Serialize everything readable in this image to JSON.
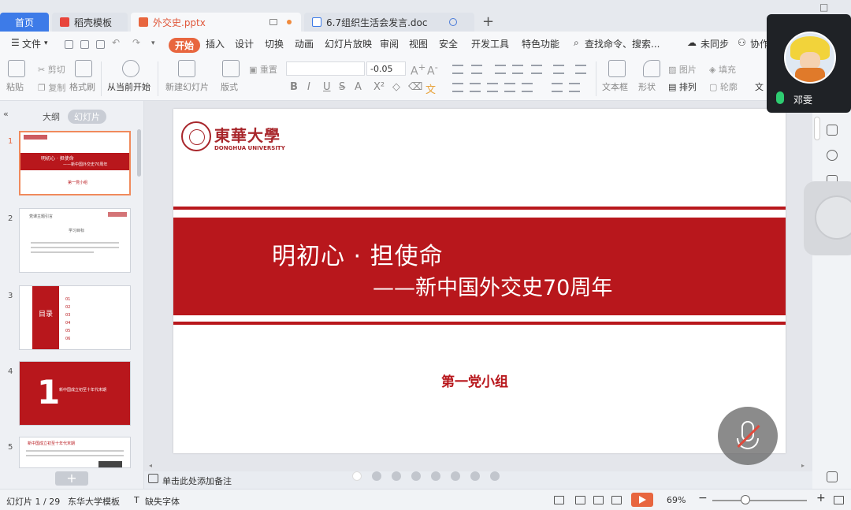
{
  "tabs": {
    "home": "首页",
    "template": "稻壳模板",
    "active_doc": "外交史.pptx",
    "other_doc": "6.7组织生活会发言.doc",
    "new_tab": "+"
  },
  "menu": {
    "file": "文件",
    "items": [
      "开始",
      "插入",
      "设计",
      "切换",
      "动画",
      "幻灯片放映",
      "审阅",
      "视图",
      "安全",
      "开发工具",
      "特色功能"
    ],
    "search": "查找命令、搜索...",
    "sync": "未同步",
    "collab": "协作"
  },
  "ribbon": {
    "paste": "粘贴",
    "cut": "剪切",
    "copy": "复制",
    "format_painter": "格式刷",
    "from_current": "从当前开始",
    "new_slide": "新建幻灯片",
    "layout": "版式",
    "reset": "重置",
    "font_size": "-0.05",
    "text_box": "文本框",
    "shapes": "形状",
    "picture": "图片",
    "fill": "填充",
    "arrange": "排列",
    "outline": "轮廓",
    "text_more": "文"
  },
  "left_panel": {
    "outline_tab": "大纲",
    "slides_tab": "幻灯片",
    "thumbnails": [
      {
        "num": "1",
        "title": "明初心 · 担使命",
        "subtitle": "——新中国外交史70周年",
        "footer": "第一党小组"
      },
      {
        "num": "2",
        "title": "党课主题引言",
        "subtitle": "学习目标"
      },
      {
        "num": "3",
        "title": "目录",
        "items": [
          "01",
          "02",
          "03",
          "04",
          "05",
          "06"
        ]
      },
      {
        "num": "4",
        "big": "1",
        "title": "新中国成立初至十年代末期"
      },
      {
        "num": "5",
        "title": "新中国成立初至十年代末期"
      }
    ],
    "add": "+"
  },
  "slide": {
    "logo_cn": "東華大學",
    "logo_en": "DONGHUA UNIVERSITY",
    "title": "明初心 · 担使命",
    "subtitle": "——新中国外交史70周年",
    "group": "第一党小组"
  },
  "notes": {
    "placeholder": "单击此处添加备注"
  },
  "video": {
    "name": "邓雯"
  },
  "status": {
    "slide_pos": "幻灯片 1 / 29",
    "template": "东华大学模板",
    "missing_font": "缺失字体",
    "zoom": "69%"
  },
  "colors": {
    "brand_red": "#b8171c",
    "accent_orange": "#e8663f",
    "home_blue": "#3d7be8"
  }
}
